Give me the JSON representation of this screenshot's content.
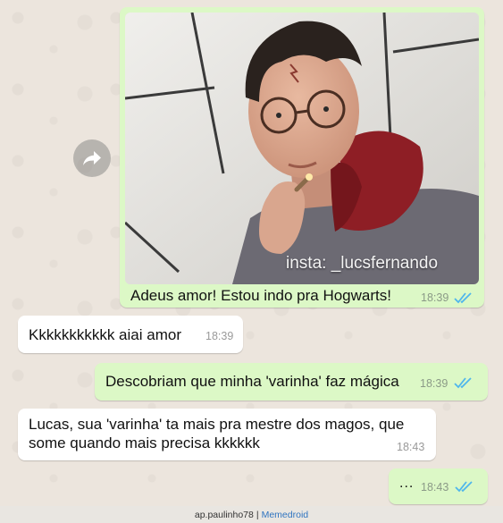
{
  "photo_message": {
    "watermark": "insta: _lucsfernando",
    "caption": "Adeus amor! Estou indo pra Hogwarts!",
    "time": "18:39"
  },
  "messages": [
    {
      "direction": "in",
      "text": "Kkkkkkkkkkk aiai amor",
      "time": "18:39"
    },
    {
      "direction": "out",
      "text": "Descobriam que minha 'varinha' faz mágica",
      "time": "18:39"
    },
    {
      "direction": "in",
      "text_lines": [
        "Lucas, sua 'varinha' ta mais pra mestre dos magos, que",
        "some quando mais precisa kkkkkk"
      ],
      "time": "18:43"
    },
    {
      "direction": "out",
      "text": "...",
      "time": "18:43"
    }
  ],
  "footer": {
    "user": "ap.paulinho78",
    "separator": "|",
    "brand": "Memedroid"
  },
  "icons": {
    "forward": "forward-arrow-icon",
    "read_receipt": "double-check-icon"
  },
  "colors": {
    "outgoing_bubble": "#dcf8c6",
    "incoming_bubble": "#ffffff",
    "read_ticks": "#4fb6ec",
    "chat_background": "#ece5dd"
  }
}
